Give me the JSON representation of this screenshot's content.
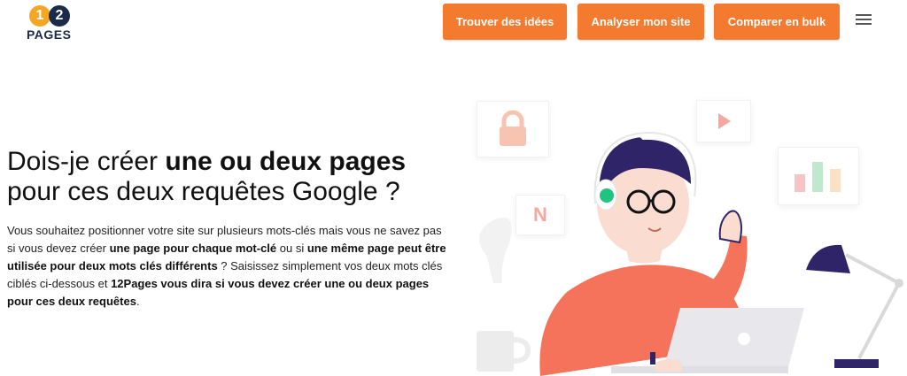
{
  "header": {
    "logo": {
      "digit1": "1",
      "digit2": "2",
      "word": "PAGES"
    },
    "buttons": {
      "find_ideas": "Trouver des idées",
      "analyze_site": "Analyser mon site",
      "compare_bulk": "Comparer en bulk"
    },
    "menu_icon": "hamburger-icon"
  },
  "hero": {
    "title_part1": "Dois-je créer ",
    "title_bold": "une ou deux pages",
    "title_part2": " pour ces deux requêtes Google ?",
    "desc_1": "Vous souhaitez positionner votre site sur plusieurs mots-clés mais vous ne savez pas si vous devez créer ",
    "desc_bold_1": "une page pour chaque mot-clé",
    "desc_2": " ou si ",
    "desc_bold_2": "une même page peut être utilisée pour deux mots clés différents",
    "desc_3": " ? Saisissez simplement vos deux mots clés ciblés ci-dessous et ",
    "desc_bold_3": "12Pages vous dira si vous devez créer une ou deux pages pour ces deux requêtes",
    "desc_4": "."
  },
  "illustration": {
    "card_n_letter": "N",
    "icons": [
      "lock-icon",
      "play-icon",
      "bar-chart-icon",
      "laptop-icon",
      "desk-lamp-icon",
      "mug-icon",
      "headphones-icon"
    ]
  },
  "colors": {
    "accent": "#f47a2f",
    "logo_orange": "#f5a623",
    "logo_navy": "#1b2a47",
    "shirt": "#f4735a",
    "headphones_green": "#1fc47f",
    "lamp_purple": "#2f2468"
  }
}
